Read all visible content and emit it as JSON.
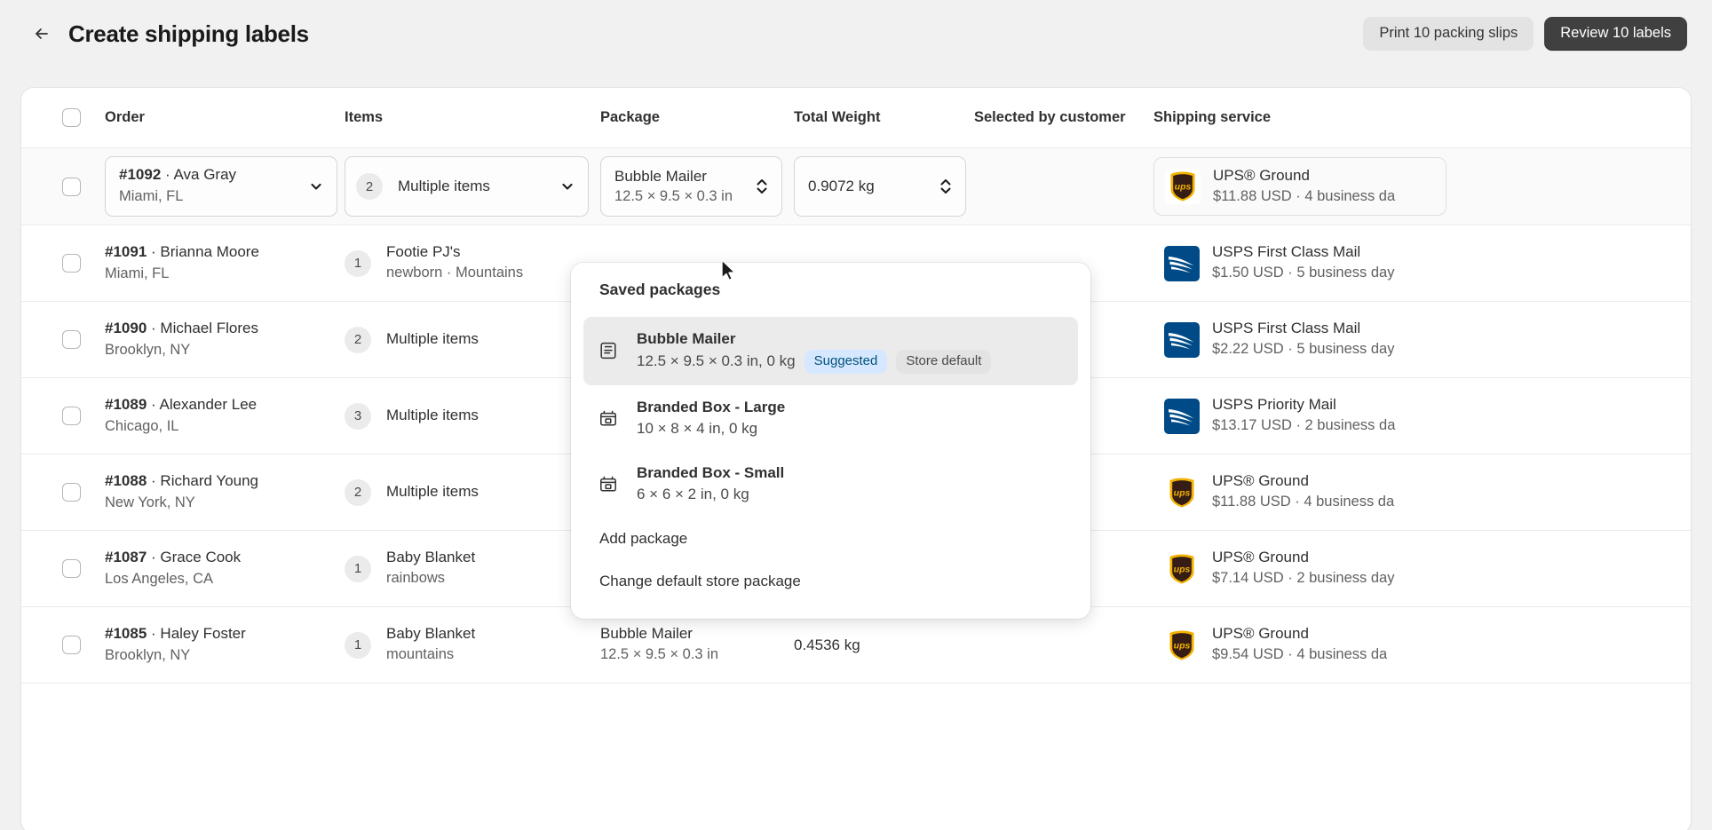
{
  "header": {
    "back_icon": "arrow-left-icon",
    "title": "Create shipping labels",
    "print_slips_label": "Print 10 packing slips",
    "review_labels_label": "Review 10 labels"
  },
  "table": {
    "columns": {
      "order": "Order",
      "items": "Items",
      "package": "Package",
      "total_weight": "Total Weight",
      "selected_by_customer": "Selected by customer",
      "shipping_service": "Shipping service"
    },
    "rows": [
      {
        "order_number": "#1092",
        "separator": "·",
        "customer": "Ava Gray",
        "location": "Miami, FL",
        "qty": "2",
        "item_title": "Multiple items",
        "item_sub": "",
        "package_name": "Bubble Mailer",
        "package_dims": "12.5 × 9.5 × 0.3 in",
        "weight": "0.9072 kg",
        "carrier": "ups",
        "service": "UPS® Ground",
        "rate": "$11.88 USD · 4 business da"
      },
      {
        "order_number": "#1091",
        "separator": "·",
        "customer": "Brianna Moore",
        "location": "Miami, FL",
        "qty": "1",
        "item_title": "Footie PJ's",
        "item_sub": "newborn · Mountains",
        "package_name": "",
        "package_dims": "",
        "weight": "",
        "carrier": "usps",
        "service": "USPS First Class Mail",
        "rate": "$1.50 USD · 5 business day"
      },
      {
        "order_number": "#1090",
        "separator": "·",
        "customer": "Michael Flores",
        "location": "Brooklyn, NY",
        "qty": "2",
        "item_title": "Multiple items",
        "item_sub": "",
        "package_name": "",
        "package_dims": "",
        "weight": "",
        "carrier": "usps",
        "service": "USPS First Class Mail",
        "rate": "$2.22 USD · 5 business day"
      },
      {
        "order_number": "#1089",
        "separator": "·",
        "customer": "Alexander Lee",
        "location": "Chicago, IL",
        "qty": "3",
        "item_title": "Multiple items",
        "item_sub": "",
        "package_name": "",
        "package_dims": "",
        "weight": "",
        "carrier": "usps",
        "service": "USPS Priority Mail",
        "rate": "$13.17 USD · 2 business da"
      },
      {
        "order_number": "#1088",
        "separator": "·",
        "customer": "Richard Young",
        "location": "New York, NY",
        "qty": "2",
        "item_title": "Multiple items",
        "item_sub": "",
        "package_name": "",
        "package_dims": "",
        "weight": "",
        "carrier": "ups",
        "service": "UPS® Ground",
        "rate": "$11.88 USD · 4 business da"
      },
      {
        "order_number": "#1087",
        "separator": "·",
        "customer": "Grace Cook",
        "location": "Los Angeles, CA",
        "qty": "1",
        "item_title": "Baby Blanket",
        "item_sub": "rainbows",
        "package_name": "",
        "package_dims": "",
        "weight": "",
        "carrier": "ups",
        "service": "UPS® Ground",
        "rate": "$7.14 USD · 2 business day"
      },
      {
        "order_number": "#1085",
        "separator": "·",
        "customer": "Haley Foster",
        "location": "Brooklyn, NY",
        "qty": "1",
        "item_title": "Baby Blanket",
        "item_sub": "mountains",
        "package_name": "Bubble Mailer",
        "package_dims": "12.5 × 9.5 × 0.3 in",
        "weight": "0.4536 kg",
        "carrier": "ups",
        "service": "UPS® Ground",
        "rate": "$9.54 USD · 4 business da"
      }
    ]
  },
  "popover": {
    "heading": "Saved packages",
    "items": [
      {
        "icon": "mailer-icon",
        "title": "Bubble Mailer",
        "desc": "12.5 × 9.5 × 0.3 in, 0 kg",
        "badges": [
          "Suggested",
          "Store default"
        ]
      },
      {
        "icon": "box-icon",
        "title": "Branded Box - Large",
        "desc": "10 × 8 × 4 in, 0 kg",
        "badges": []
      },
      {
        "icon": "box-icon",
        "title": "Branded Box - Small",
        "desc": "6 × 6 × 2 in, 0 kg",
        "badges": []
      }
    ],
    "add_package_label": "Add package",
    "change_default_label": "Change default store package"
  },
  "colors": {
    "primary_button": "#404040",
    "suggested_badge_bg": "#d6e8ff",
    "suggested_badge_text": "#00527c",
    "ups_gold": "#f2b200",
    "ups_brown": "#351c15",
    "usps_blue": "#004b87"
  }
}
